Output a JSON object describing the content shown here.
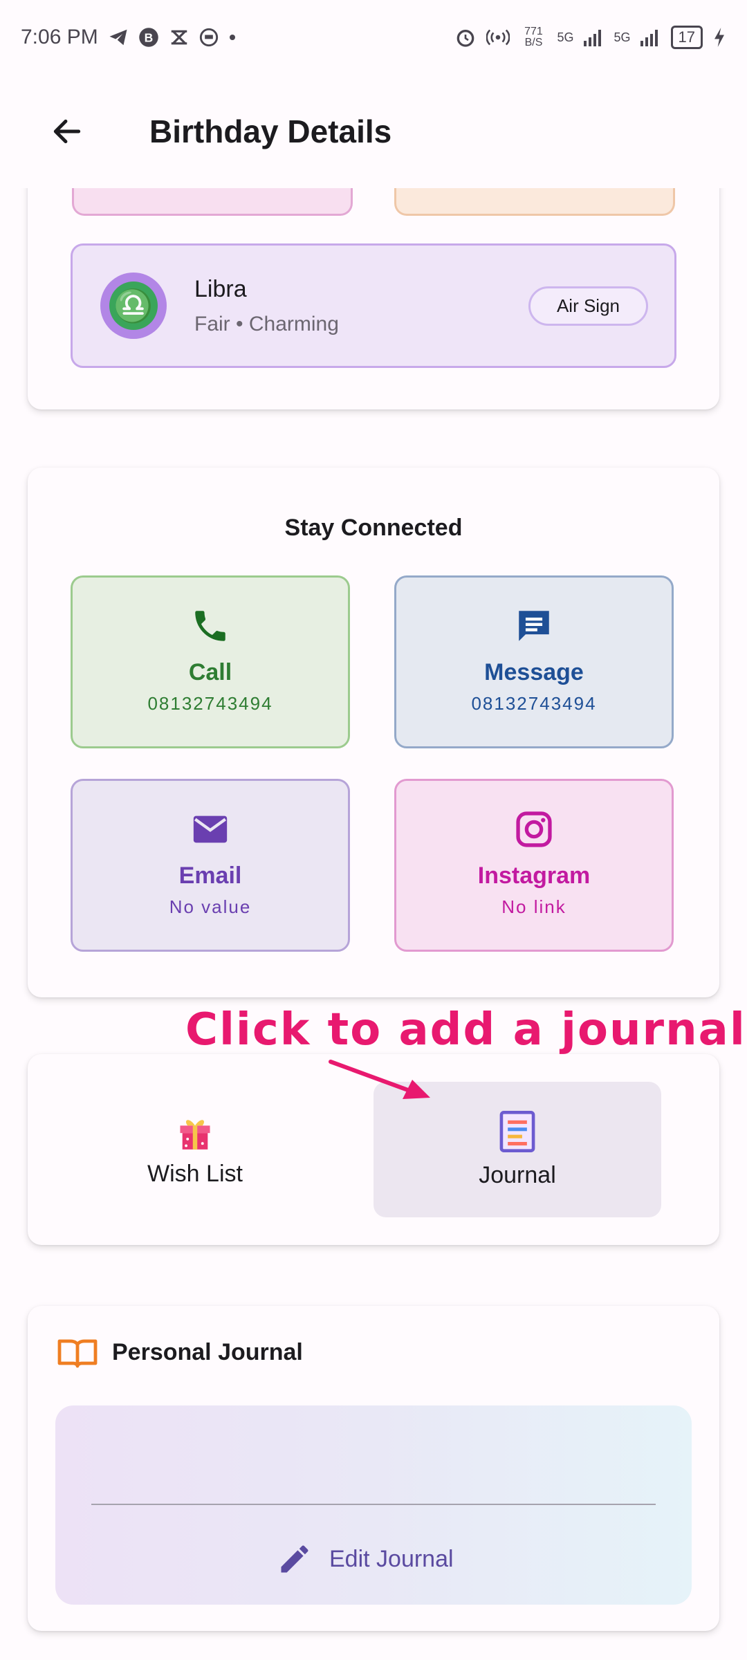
{
  "status_bar": {
    "time": "7:06 PM",
    "net_speed": "771 B/S",
    "signal_1": "5G",
    "signal_2": "5G",
    "battery": "17"
  },
  "app_bar": {
    "title": "Birthday Details"
  },
  "zodiac": {
    "name": "Libra",
    "traits": "Fair • Charming",
    "element": "Air Sign",
    "symbol": "♎"
  },
  "stay_connected": {
    "title": "Stay Connected",
    "tiles": [
      {
        "label": "Call",
        "value": "08132743494",
        "icon": "phone-icon",
        "color": "#2e7d32"
      },
      {
        "label": "Message",
        "value": "08132743494",
        "icon": "message-icon",
        "color": "#1e4f96"
      },
      {
        "label": "Email",
        "value": "No value",
        "icon": "mail-icon",
        "color": "#6a3fb0"
      },
      {
        "label": "Instagram",
        "value": "No link",
        "icon": "instagram-icon",
        "color": "#c21aa0"
      }
    ]
  },
  "tabs": {
    "wish_list": "Wish List",
    "journal": "Journal"
  },
  "annotation": {
    "text": "Click to add a journal"
  },
  "personal_journal": {
    "title": "Personal Journal",
    "edit_label": "Edit Journal"
  }
}
